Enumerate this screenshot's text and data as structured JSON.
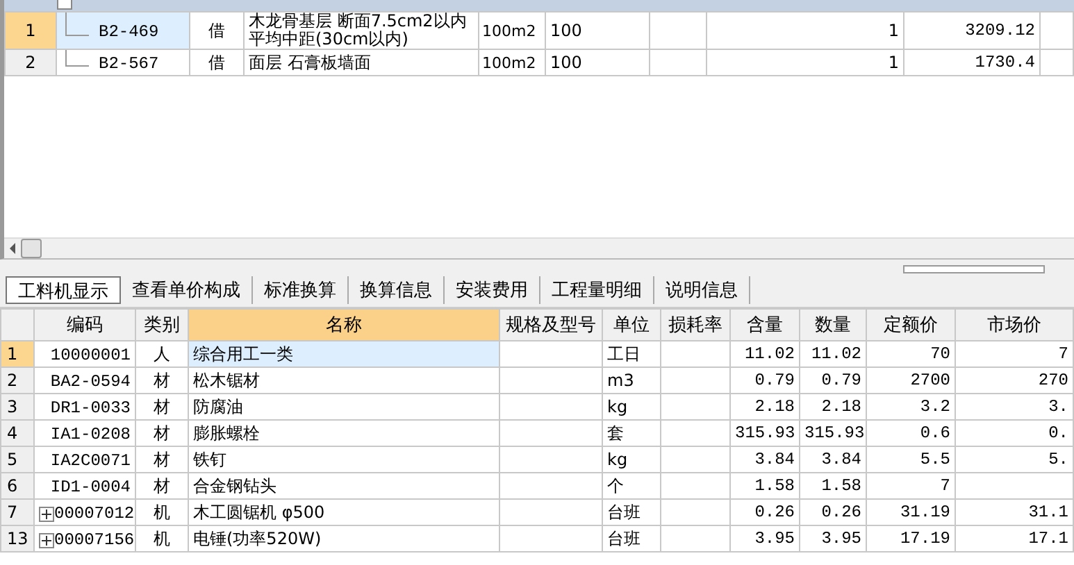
{
  "top_table": {
    "rows": [
      {
        "number": "1",
        "code": "B2-469",
        "type": "借",
        "name": "木龙骨基层 断面7.5cm2以内平均中距(30cm以内)",
        "unit": "100m2",
        "quantity": "100",
        "column_7": "",
        "column_8": "1",
        "column_9": "3209.12",
        "selected": true
      },
      {
        "number": "2",
        "code": "B2-567",
        "type": "借",
        "name": "面层 石膏板墙面",
        "unit": "100m2",
        "quantity": "100",
        "column_7": "",
        "column_8": "1",
        "column_9": "1730.4",
        "selected": false
      }
    ]
  },
  "tabs": [
    {
      "label": "工料机显示",
      "selected": true
    },
    {
      "label": "查看单价构成",
      "selected": false
    },
    {
      "label": "标准换算",
      "selected": false
    },
    {
      "label": "换算信息",
      "selected": false
    },
    {
      "label": "安装费用",
      "selected": false
    },
    {
      "label": "工程量明细",
      "selected": false
    },
    {
      "label": "说明信息",
      "selected": false
    }
  ],
  "bottom_table": {
    "columns": [
      {
        "selected": false
      },
      {
        "label": "编码",
        "selected": false
      },
      {
        "label": "类别",
        "selected": false
      },
      {
        "label": "名称",
        "selected": true
      },
      {
        "label": "规格及型号",
        "selected": false
      },
      {
        "label": "单位",
        "selected": false
      },
      {
        "label": "损耗率",
        "selected": false
      },
      {
        "label": "含量",
        "selected": false
      },
      {
        "label": "数量",
        "selected": false
      },
      {
        "label": "定额价",
        "selected": false
      },
      {
        "label": "市场价",
        "selected": false
      }
    ],
    "rows": [
      {
        "number": "1",
        "expandable": false,
        "code": "10000001",
        "category": "人",
        "name": "综合用工一类",
        "spec": "",
        "unit": "工日",
        "loss_rate": "",
        "content": "11.02",
        "quantity": "11.02",
        "quota_price": "70",
        "market_price": "7",
        "selected": true
      },
      {
        "number": "2",
        "expandable": false,
        "code": "BA2-0594",
        "category": "材",
        "name": "松木锯材",
        "spec": "",
        "unit": "m3",
        "loss_rate": "",
        "content": "0.79",
        "quantity": "0.79",
        "quota_price": "2700",
        "market_price": "270",
        "selected": false
      },
      {
        "number": "3",
        "expandable": false,
        "code": "DR1-0033",
        "category": "材",
        "name": "防腐油",
        "spec": "",
        "unit": "kg",
        "loss_rate": "",
        "content": "2.18",
        "quantity": "2.18",
        "quota_price": "3.2",
        "market_price": "3.",
        "selected": false
      },
      {
        "number": "4",
        "expandable": false,
        "code": "IA1-0208",
        "category": "材",
        "name": "膨胀螺栓",
        "spec": "",
        "unit": "套",
        "loss_rate": "",
        "content": "315.93",
        "quantity": "315.93",
        "quota_price": "0.6",
        "market_price": "0.",
        "selected": false
      },
      {
        "number": "5",
        "expandable": false,
        "code": "IA2C0071",
        "category": "材",
        "name": "铁钉",
        "spec": "",
        "unit": "kg",
        "loss_rate": "",
        "content": "3.84",
        "quantity": "3.84",
        "quota_price": "5.5",
        "market_price": "5.",
        "selected": false
      },
      {
        "number": "6",
        "expandable": false,
        "code": "ID1-0004",
        "category": "材",
        "name": "合金钢钻头",
        "spec": "",
        "unit": "个",
        "loss_rate": "",
        "content": "1.58",
        "quantity": "1.58",
        "quota_price": "7",
        "market_price": "",
        "selected": false
      },
      {
        "number": "7",
        "expandable": true,
        "code": "00007012",
        "category": "机",
        "name": "木工圆锯机 φ500",
        "spec": "",
        "unit": "台班",
        "loss_rate": "",
        "content": "0.26",
        "quantity": "0.26",
        "quota_price": "31.19",
        "market_price": "31.1",
        "selected": false
      },
      {
        "number": "13",
        "expandable": true,
        "code": "00007156",
        "category": "机",
        "name": "电锤(功率520W)",
        "spec": "",
        "unit": "台班",
        "loss_rate": "",
        "content": "3.95",
        "quantity": "3.95",
        "quota_price": "17.19",
        "market_price": "17.1",
        "selected": false
      }
    ]
  }
}
